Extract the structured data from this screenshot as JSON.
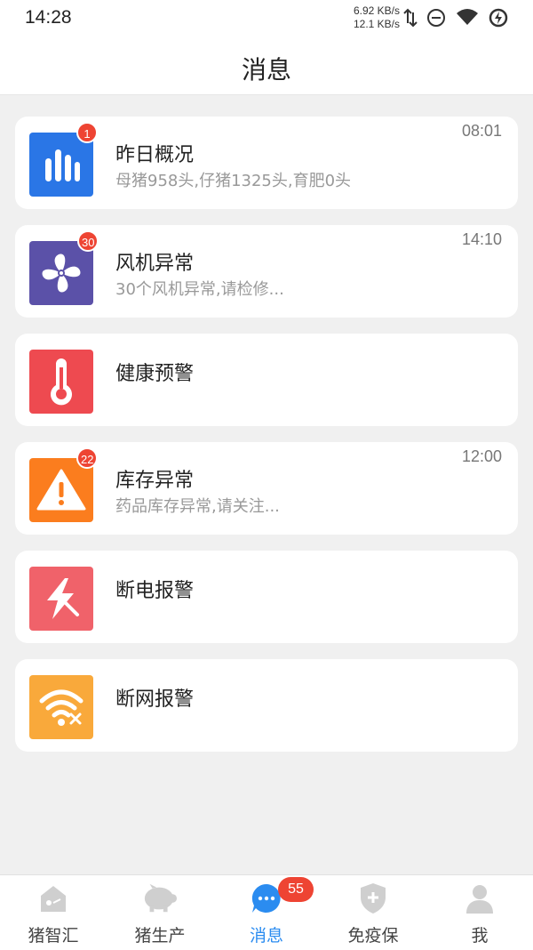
{
  "status_bar": {
    "time": "14:28",
    "speed_up": "6.92 KB/s",
    "speed_down": "12.1 KB/s",
    "icons": [
      "data-transfer-icon",
      "do-not-disturb-icon",
      "wifi-icon",
      "battery-charging-icon"
    ]
  },
  "header": {
    "title": "消息"
  },
  "messages": [
    {
      "title": "昨日概况",
      "subtitle": "母猪958头,仔猪1325头,育肥0头",
      "time": "08:01",
      "badge": "1",
      "icon": "bar-chart-icon",
      "color": "#2a76e6"
    },
    {
      "title": "风机异常",
      "subtitle": "30个风机异常,请检修...",
      "time": "14:10",
      "badge": "30",
      "icon": "fan-icon",
      "color": "#5b51a8"
    },
    {
      "title": "健康预警",
      "subtitle": "",
      "time": "",
      "badge": "",
      "icon": "thermometer-icon",
      "color": "#ee4a50"
    },
    {
      "title": "库存异常",
      "subtitle": "药品库存异常,请关注...",
      "time": "12:00",
      "badge": "22",
      "icon": "warning-icon",
      "color": "#fb7d1e"
    },
    {
      "title": "断电报警",
      "subtitle": "",
      "time": "",
      "badge": "",
      "icon": "power-off-icon",
      "color": "#f0626a"
    },
    {
      "title": "断网报警",
      "subtitle": "",
      "time": "",
      "badge": "",
      "icon": "wifi-off-icon",
      "color": "#f9a93b"
    }
  ],
  "tabs": [
    {
      "label": "猪智汇",
      "icon": "home-icon",
      "active": false
    },
    {
      "label": "猪生产",
      "icon": "pig-icon",
      "active": false
    },
    {
      "label": "消息",
      "icon": "message-icon",
      "active": true,
      "badge": "55"
    },
    {
      "label": "免疫保",
      "icon": "shield-plus-icon",
      "active": false
    },
    {
      "label": "我",
      "icon": "user-icon",
      "active": false
    }
  ],
  "colors": {
    "accent": "#2b8cf0",
    "badge": "#ee4433",
    "inactive_icon": "#cfcfcf"
  }
}
